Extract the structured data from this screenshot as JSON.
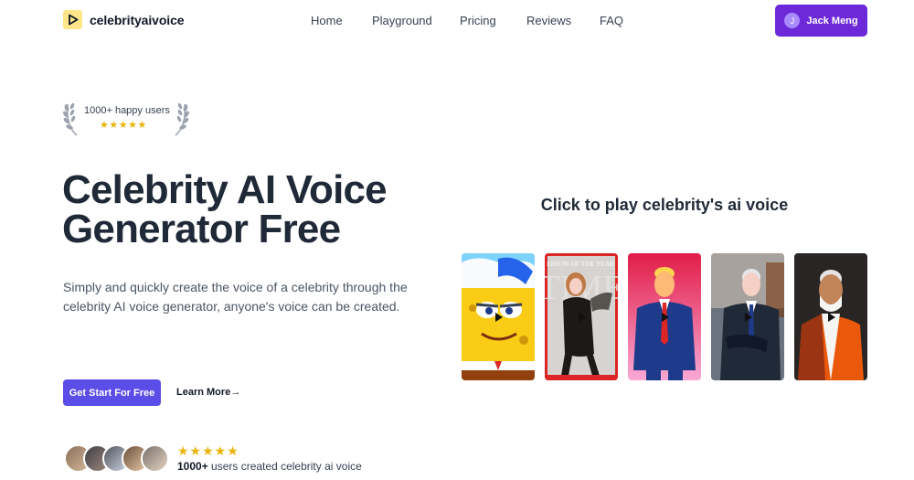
{
  "header": {
    "logo_text": "celebrityaivoice",
    "nav": [
      "Home",
      "Playground",
      "Pricing",
      "Reviews",
      "FAQ"
    ],
    "user": {
      "initial": "J",
      "name": "Jack Meng"
    }
  },
  "badge": {
    "text": "1000+ happy users",
    "stars": "★★★★★"
  },
  "hero": {
    "title_line1": "Celebrity AI Voice",
    "title_line2": "Generator Free",
    "description": "Simply and quickly create the voice of a celebrity through the celebrity AI voice generator, anyone's voice can be created.",
    "cta_primary": "Get Start For Free",
    "cta_secondary": "Learn More→"
  },
  "proof": {
    "stars": "★★★★★",
    "count": "1000+",
    "text": " users created celebrity ai voice"
  },
  "play_section": {
    "title": "Click to play celebrity's ai voice",
    "cards": [
      {
        "name": "spongebob-card",
        "accent": "#facc15",
        "bg": "#60a5fa"
      },
      {
        "name": "magazine-cover-card",
        "accent": "#dc2626",
        "bg": "#e5e7eb",
        "cover_text": "ERSON OF THE YEAR"
      },
      {
        "name": "trump-card",
        "accent": "#1e3a8a",
        "bg": "#dc2656"
      },
      {
        "name": "biden-card",
        "accent": "#1f2937",
        "bg": "#9ca3af"
      },
      {
        "name": "modi-card",
        "accent": "#c2410c",
        "bg": "#44403c"
      }
    ]
  },
  "colors": {
    "primary": "#6d28d9",
    "cta": "#5b4de8",
    "star": "#eab308"
  }
}
